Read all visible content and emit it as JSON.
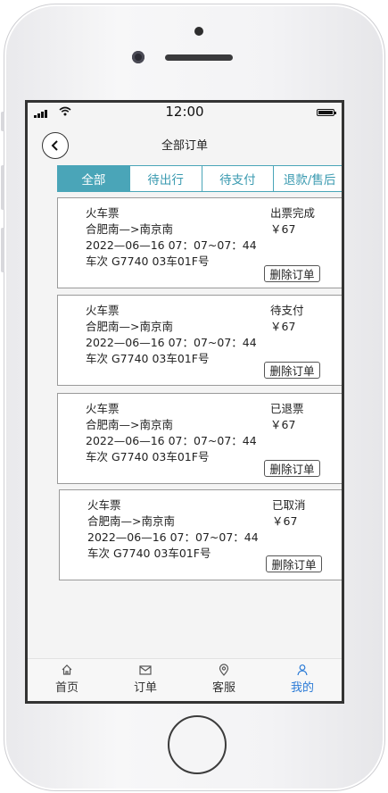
{
  "status_bar": {
    "time": "12:00"
  },
  "header": {
    "title": "全部订单"
  },
  "tabs": [
    {
      "label": "全部",
      "active": true
    },
    {
      "label": "待出行",
      "active": false
    },
    {
      "label": "待支付",
      "active": false
    },
    {
      "label": "退款/售后",
      "active": false
    }
  ],
  "orders": [
    {
      "type": "火车票",
      "route": "合肥南—>南京南",
      "datetime": "2022—06—16 07：07~07：44",
      "train": "车次 G7740  03车01F号",
      "status": "出票完成",
      "price": "￥67",
      "delete_label": "删除订单"
    },
    {
      "type": "火车票",
      "route": "合肥南—>南京南",
      "datetime": "2022—06—16 07：07~07：44",
      "train": "车次 G7740  03车01F号",
      "status": "待支付",
      "price": "￥67",
      "delete_label": "删除订单"
    },
    {
      "type": "火车票",
      "route": "合肥南—>南京南",
      "datetime": "2022—06—16 07：07~07：44",
      "train": "车次 G7740  03车01F号",
      "status": "已退票",
      "price": "￥67",
      "delete_label": "删除订单"
    },
    {
      "type": "火车票",
      "route": "合肥南—>南京南",
      "datetime": "2022—06—16 07：07~07：44",
      "train": "车次 G7740  03车01F号",
      "status": "已取消",
      "price": "￥67",
      "delete_label": "删除订单"
    }
  ],
  "nav": [
    {
      "label": "首页",
      "icon": "home-icon"
    },
    {
      "label": "订单",
      "icon": "mail-icon"
    },
    {
      "label": "客服",
      "icon": "location-pin-icon"
    },
    {
      "label": "我的",
      "icon": "user-icon",
      "active": true
    }
  ],
  "colors": {
    "accent": "#4aa5b8",
    "nav_active": "#2a7ad6"
  }
}
